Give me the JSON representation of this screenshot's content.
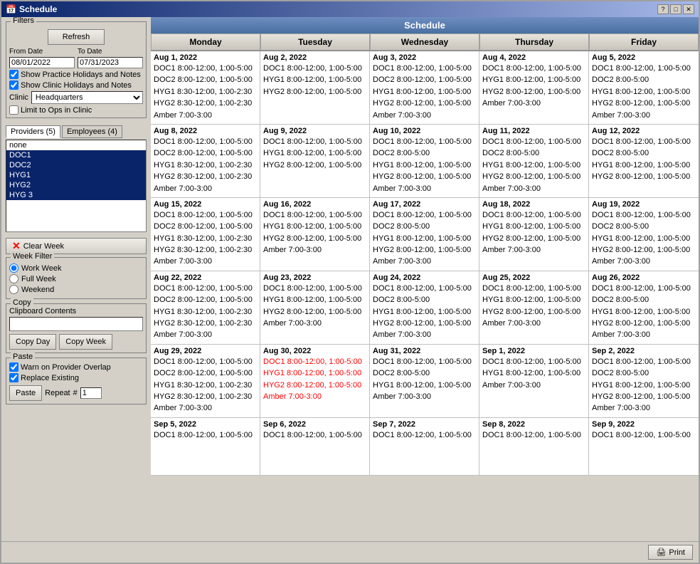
{
  "window": {
    "title": "Schedule",
    "title_icon": "📅"
  },
  "sidebar": {
    "filters_label": "Filters",
    "refresh_label": "Refresh",
    "from_date_label": "From Date",
    "from_date_value": "08/01/2022",
    "to_date_label": "To Date",
    "to_date_value": "07/31/2023",
    "show_practice_label": "Show Practice Holidays and Notes",
    "show_clinic_label": "Show Clinic Holidays and Notes",
    "clinic_label": "Clinic",
    "clinic_value": "Headquarters",
    "limit_ops_label": "Limit to Ops in Clinic",
    "providers_tab": "Providers (5)",
    "employees_tab": "Employees (4)",
    "providers": [
      "none",
      "DOC1",
      "DOC2",
      "HYG1",
      "HYG2",
      "HYG 3"
    ],
    "clear_week_label": "Clear Week",
    "week_filter_label": "Week Filter",
    "work_week_label": "Work Week",
    "full_week_label": "Full Week",
    "weekend_label": "Weekend",
    "copy_label": "Copy",
    "clipboard_label": "Clipboard Contents",
    "clipboard_value": "",
    "copy_day_label": "Copy Day",
    "copy_week_label": "Copy Week",
    "paste_label": "Paste",
    "warn_overlap_label": "Warn on Provider Overlap",
    "replace_existing_label": "Replace Existing",
    "paste_btn_label": "Paste",
    "repeat_label": "Repeat",
    "repeat_value": "1",
    "print_label": "Print"
  },
  "schedule": {
    "title": "Schedule",
    "headers": [
      "Monday",
      "Tuesday",
      "Wednesday",
      "Thursday",
      "Friday"
    ],
    "weeks": [
      {
        "days": [
          {
            "date": "Aug 1, 2022",
            "entries": [
              "DOC1 8:00-12:00, 1:00-5:00",
              "DOC2 8:00-12:00, 1:00-5:00",
              "HYG1 8:30-12:00, 1:00-2:30",
              "HYG2 8:30-12:00, 1:00-2:30",
              "Amber 7:00-3:00"
            ],
            "red_entries": []
          },
          {
            "date": "Aug 2, 2022",
            "entries": [
              "DOC1 8:00-12:00, 1:00-5:00",
              "HYG1 8:00-12:00, 1:00-5:00",
              "HYG2 8:00-12:00, 1:00-5:00"
            ],
            "red_entries": []
          },
          {
            "date": "Aug 3, 2022",
            "entries": [
              "DOC1 8:00-12:00, 1:00-5:00",
              "DOC2 8:00-12:00, 1:00-5:00",
              "HYG1 8:00-12:00, 1:00-5:00",
              "HYG2 8:00-12:00, 1:00-5:00",
              "Amber 7:00-3:00"
            ],
            "red_entries": []
          },
          {
            "date": "Aug 4, 2022",
            "entries": [
              "DOC1 8:00-12:00, 1:00-5:00",
              "HYG1 8:00-12:00, 1:00-5:00",
              "HYG2 8:00-12:00, 1:00-5:00",
              "Amber 7:00-3:00"
            ],
            "red_entries": []
          },
          {
            "date": "Aug 5, 2022",
            "entries": [
              "DOC1 8:00-12:00, 1:00-5:00",
              "DOC2 8:00-5:00",
              "HYG1 8:00-12:00, 1:00-5:00",
              "HYG2 8:00-12:00, 1:00-5:00",
              "Amber 7:00-3:00"
            ],
            "red_entries": []
          }
        ]
      },
      {
        "days": [
          {
            "date": "Aug 8, 2022",
            "entries": [
              "DOC1 8:00-12:00, 1:00-5:00",
              "DOC2 8:00-12:00, 1:00-5:00",
              "HYG1 8:30-12:00, 1:00-2:30",
              "HYG2 8:30-12:00, 1:00-2:30",
              "Amber 7:00-3:00"
            ],
            "red_entries": []
          },
          {
            "date": "Aug 9, 2022",
            "entries": [
              "DOC1 8:00-12:00, 1:00-5:00",
              "HYG1 8:00-12:00, 1:00-5:00",
              "HYG2 8:00-12:00, 1:00-5:00"
            ],
            "red_entries": []
          },
          {
            "date": "Aug 10, 2022",
            "entries": [
              "DOC1 8:00-12:00, 1:00-5:00",
              "DOC2 8:00-5:00",
              "HYG1 8:00-12:00, 1:00-5:00",
              "HYG2 8:00-12:00, 1:00-5:00",
              "Amber 7:00-3:00"
            ],
            "red_entries": []
          },
          {
            "date": "Aug 11, 2022",
            "entries": [
              "DOC1 8:00-12:00, 1:00-5:00",
              "DOC2 8:00-5:00",
              "HYG1 8:00-12:00, 1:00-5:00",
              "HYG2 8:00-12:00, 1:00-5:00",
              "Amber 7:00-3:00"
            ],
            "red_entries": []
          },
          {
            "date": "Aug 12, 2022",
            "entries": [
              "DOC1 8:00-12:00, 1:00-5:00",
              "DOC2 8:00-5:00",
              "HYG1 8:00-12:00, 1:00-5:00",
              "HYG2 8:00-12:00, 1:00-5:00"
            ],
            "red_entries": []
          }
        ]
      },
      {
        "days": [
          {
            "date": "Aug 15, 2022",
            "entries": [
              "DOC1 8:00-12:00, 1:00-5:00",
              "DOC2 8:00-12:00, 1:00-5:00",
              "HYG1 8:30-12:00, 1:00-2:30",
              "HYG2 8:30-12:00, 1:00-2:30",
              "Amber 7:00-3:00"
            ],
            "red_entries": []
          },
          {
            "date": "Aug 16, 2022",
            "entries": [
              "DOC1 8:00-12:00, 1:00-5:00",
              "HYG1 8:00-12:00, 1:00-5:00",
              "HYG2 8:00-12:00, 1:00-5:00",
              "Amber 7:00-3:00"
            ],
            "red_entries": []
          },
          {
            "date": "Aug 17, 2022",
            "entries": [
              "DOC1 8:00-12:00, 1:00-5:00",
              "DOC2 8:00-5:00",
              "HYG1 8:00-12:00, 1:00-5:00",
              "HYG2 8:00-12:00, 1:00-5:00",
              "Amber 7:00-3:00"
            ],
            "red_entries": []
          },
          {
            "date": "Aug 18, 2022",
            "entries": [
              "DOC1 8:00-12:00, 1:00-5:00",
              "HYG1 8:00-12:00, 1:00-5:00",
              "HYG2 8:00-12:00, 1:00-5:00",
              "Amber 7:00-3:00"
            ],
            "red_entries": []
          },
          {
            "date": "Aug 19, 2022",
            "entries": [
              "DOC1 8:00-12:00, 1:00-5:00",
              "DOC2 8:00-5:00",
              "HYG1 8:00-12:00, 1:00-5:00",
              "HYG2 8:00-12:00, 1:00-5:00",
              "Amber 7:00-3:00"
            ],
            "red_entries": []
          }
        ]
      },
      {
        "days": [
          {
            "date": "Aug 22, 2022",
            "entries": [
              "DOC1 8:00-12:00, 1:00-5:00",
              "DOC2 8:00-12:00, 1:00-5:00",
              "HYG1 8:30-12:00, 1:00-2:30",
              "HYG2 8:30-12:00, 1:00-2:30",
              "Amber 7:00-3:00"
            ],
            "red_entries": []
          },
          {
            "date": "Aug 23, 2022",
            "entries": [
              "DOC1 8:00-12:00, 1:00-5:00",
              "HYG1 8:00-12:00, 1:00-5:00",
              "HYG2 8:00-12:00, 1:00-5:00",
              "Amber 7:00-3:00"
            ],
            "red_entries": []
          },
          {
            "date": "Aug 24, 2022",
            "entries": [
              "DOC1 8:00-12:00, 1:00-5:00",
              "DOC2 8:00-5:00",
              "HYG1 8:00-12:00, 1:00-5:00",
              "HYG2 8:00-12:00, 1:00-5:00",
              "Amber 7:00-3:00"
            ],
            "red_entries": []
          },
          {
            "date": "Aug 25, 2022",
            "entries": [
              "DOC1 8:00-12:00, 1:00-5:00",
              "HYG1 8:00-12:00, 1:00-5:00",
              "HYG2 8:00-12:00, 1:00-5:00",
              "Amber 7:00-3:00"
            ],
            "red_entries": []
          },
          {
            "date": "Aug 26, 2022",
            "entries": [
              "DOC1 8:00-12:00, 1:00-5:00",
              "DOC2 8:00-5:00",
              "HYG1 8:00-12:00, 1:00-5:00",
              "HYG2 8:00-12:00, 1:00-5:00",
              "Amber 7:00-3:00"
            ],
            "red_entries": []
          }
        ]
      },
      {
        "days": [
          {
            "date": "Aug 29, 2022",
            "entries": [
              "DOC1 8:00-12:00, 1:00-5:00",
              "DOC2 8:00-12:00, 1:00-5:00",
              "HYG1 8:30-12:00, 1:00-2:30",
              "HYG2 8:30-12:00, 1:00-2:30",
              "Amber 7:00-3:00"
            ],
            "red_entries": []
          },
          {
            "date": "Aug 30, 2022",
            "entries": [],
            "red_entries": [
              "DOC1 8:00-12:00, 1:00-5:00",
              "HYG1 8:00-12:00, 1:00-5:00",
              "HYG2 8:00-12:00, 1:00-5:00",
              "Amber 7:00-3:00"
            ]
          },
          {
            "date": "Aug 31, 2022",
            "entries": [
              "DOC1 8:00-12:00, 1:00-5:00",
              "DOC2 8:00-5:00",
              "HYG1 8:00-12:00, 1:00-5:00",
              "Amber 7:00-3:00"
            ],
            "red_entries": []
          },
          {
            "date": "Sep 1, 2022",
            "entries": [
              "DOC1 8:00-12:00, 1:00-5:00",
              "HYG1 8:00-12:00, 1:00-5:00",
              "Amber 7:00-3:00"
            ],
            "red_entries": []
          },
          {
            "date": "Sep 2, 2022",
            "entries": [
              "DOC1 8:00-12:00, 1:00-5:00",
              "DOC2 8:00-5:00",
              "HYG1 8:00-12:00, 1:00-5:00",
              "HYG2 8:00-12:00, 1:00-5:00",
              "Amber 7:00-3:00"
            ],
            "red_entries": []
          }
        ]
      },
      {
        "days": [
          {
            "date": "Sep 5, 2022",
            "entries": [
              "DOC1 8:00-12:00, 1:00-5:00"
            ],
            "red_entries": []
          },
          {
            "date": "Sep 6, 2022",
            "entries": [
              "DOC1 8:00-12:00, 1:00-5:00"
            ],
            "red_entries": []
          },
          {
            "date": "Sep 7, 2022",
            "entries": [
              "DOC1 8:00-12:00, 1:00-5:00"
            ],
            "red_entries": []
          },
          {
            "date": "Sep 8, 2022",
            "entries": [
              "DOC1 8:00-12:00, 1:00-5:00"
            ],
            "red_entries": []
          },
          {
            "date": "Sep 9, 2022",
            "entries": [
              "DOC1 8:00-12:00, 1:00-5:00"
            ],
            "red_entries": []
          }
        ]
      }
    ]
  }
}
